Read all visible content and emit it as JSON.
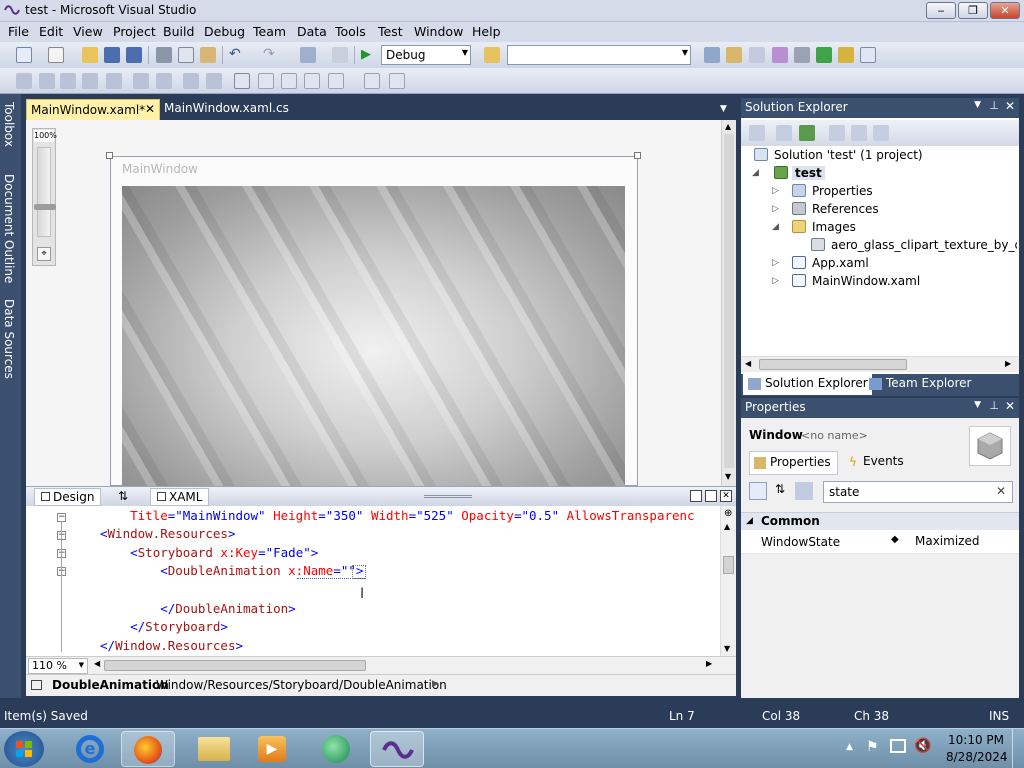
{
  "window": {
    "title": "test - Microsoft Visual Studio",
    "minimize": "‒",
    "restore": "❐",
    "close": "✕"
  },
  "menu": [
    "File",
    "Edit",
    "View",
    "Project",
    "Build",
    "Debug",
    "Team",
    "Data",
    "Tools",
    "Test",
    "Window",
    "Help"
  ],
  "toolbar": {
    "configuration": "Debug",
    "platform": ""
  },
  "left_tabs": [
    "Toolbox",
    "Document Outline",
    "Data Sources"
  ],
  "editor_tabs": [
    {
      "label": "MainWindow.xaml*",
      "active": true
    },
    {
      "label": "MainWindow.xaml.cs",
      "active": false
    }
  ],
  "designer": {
    "zoom": "100%",
    "window_title": "MainWindow"
  },
  "split": {
    "design": "Design",
    "swap": "⇅",
    "xaml": "XAML"
  },
  "code_lines": [
    [
      {
        "c": "at",
        "t": "    Title"
      },
      {
        "c": "bk",
        "t": "=\"MainWindow\""
      },
      {
        "c": "at",
        "t": " Height"
      },
      {
        "c": "bk",
        "t": "=\"350\""
      },
      {
        "c": "at",
        "t": " Width"
      },
      {
        "c": "bk",
        "t": "=\"525\""
      },
      {
        "c": "at",
        "t": " Opacity"
      },
      {
        "c": "bk",
        "t": "=\"0.5\""
      },
      {
        "c": "at",
        "t": " AllowsTransparenc"
      }
    ],
    [
      {
        "c": "bk",
        "t": "<"
      },
      {
        "c": "tg",
        "t": "Window.Resources"
      },
      {
        "c": "bk",
        "t": ">"
      }
    ],
    [
      {
        "c": "bk",
        "t": "    <"
      },
      {
        "c": "tg",
        "t": "Storyboard"
      },
      {
        "c": "at",
        "t": " x:Key"
      },
      {
        "c": "bk",
        "t": "=\"Fade\">"
      }
    ],
    [
      {
        "c": "bk",
        "t": "        <"
      },
      {
        "c": "tg",
        "t": "DoubleAnimation"
      },
      {
        "c": "at",
        "t": " x:Name"
      },
      {
        "c": "bk",
        "t": "=\"\">"
      }
    ],
    [
      {
        "c": "bk",
        "t": ""
      }
    ],
    [
      {
        "c": "bk",
        "t": "        </"
      },
      {
        "c": "tg",
        "t": "DoubleAnimation"
      },
      {
        "c": "bk",
        "t": ">"
      }
    ],
    [
      {
        "c": "bk",
        "t": "    </"
      },
      {
        "c": "tg",
        "t": "Storyboard"
      },
      {
        "c": "bk",
        "t": ">"
      }
    ],
    [
      {
        "c": "bk",
        "t": "</"
      },
      {
        "c": "tg",
        "t": "Window.Resources"
      },
      {
        "c": "bk",
        "t": ">"
      }
    ]
  ],
  "zoom_level": "110 %",
  "breadcrumb": {
    "element": "DoubleAnimation",
    "path": "Window/Resources/Storyboard/DoubleAnimation"
  },
  "solution_explorer": {
    "title": "Solution Explorer",
    "tree": [
      {
        "label": "Solution 'test' (1 project)",
        "level": 0,
        "expander": "",
        "icon": "solution-icon",
        "bold": false
      },
      {
        "label": "test",
        "level": 1,
        "expander": "◢",
        "icon": "project-icon",
        "bold": true
      },
      {
        "label": "Properties",
        "level": 2,
        "expander": "▷",
        "icon": "properties-icon",
        "bold": false
      },
      {
        "label": "References",
        "level": 2,
        "expander": "▷",
        "icon": "references-icon",
        "bold": false
      },
      {
        "label": "Images",
        "level": 2,
        "expander": "◢",
        "icon": "folder-icon",
        "bold": false
      },
      {
        "label": "aero_glass_clipart_texture_by_diamo",
        "level": 3,
        "expander": "",
        "icon": "image-file-icon",
        "bold": false
      },
      {
        "label": "App.xaml",
        "level": 2,
        "expander": "▷",
        "icon": "xaml-file-icon",
        "bold": false
      },
      {
        "label": "MainWindow.xaml",
        "level": 2,
        "expander": "▷",
        "icon": "xaml-file-icon",
        "bold": false
      }
    ],
    "tabs": [
      "Solution Explorer",
      "Team Explorer"
    ]
  },
  "properties": {
    "title": "Properties",
    "object_type": "Window",
    "object_name": "<no name>",
    "tab_properties": "Properties",
    "tab_events": "Events",
    "search_value": "state",
    "category": "Common",
    "rows": [
      {
        "name": "WindowState",
        "value": "Maximized"
      }
    ]
  },
  "status": {
    "message": "Item(s) Saved",
    "line": "Ln 7",
    "col": "Col 38",
    "ch": "Ch 38",
    "mode": "INS"
  },
  "taskbar": {
    "time": "10:10 PM",
    "date": "8/28/2024"
  }
}
